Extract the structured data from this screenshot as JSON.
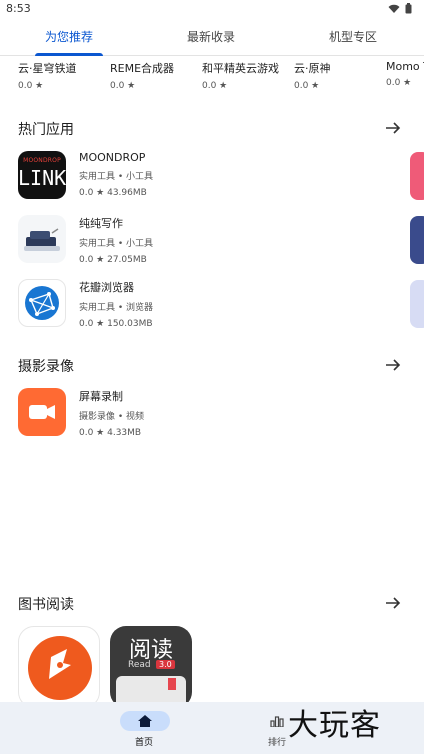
{
  "status": {
    "time": "8:53"
  },
  "tabs": [
    {
      "label": "为您推荐",
      "active": true
    },
    {
      "label": "最新收录",
      "active": false
    },
    {
      "label": "机型专区",
      "active": false
    }
  ],
  "top_row": [
    {
      "name": "云·星穹铁道",
      "rating": "0.0 ★"
    },
    {
      "name": "REME合成器",
      "rating": "0.0 ★"
    },
    {
      "name": "和平精英云游戏",
      "rating": "0.0 ★"
    },
    {
      "name": "云·原神",
      "rating": "0.0 ★"
    },
    {
      "name": "Momo T",
      "rating": "0.0 ★"
    }
  ],
  "sections": {
    "hot": {
      "title": "热门应用",
      "apps": [
        {
          "name": "MOONDROP",
          "category": "实用工具 • 小工具",
          "meta": "0.0 ★   43.96MB",
          "icon_text_top": "MOONDROP",
          "icon_text_main": "LINK"
        },
        {
          "name": "纯纯写作",
          "category": "实用工具 • 小工具",
          "meta": "0.0 ★   27.05MB"
        },
        {
          "name": "花瓣浏览器",
          "category": "实用工具 • 浏览器",
          "meta": "0.0 ★   150.03MB"
        }
      ]
    },
    "photo": {
      "title": "摄影录像",
      "apps": [
        {
          "name": "屏幕录制",
          "category": "摄影录像 • 视频",
          "meta": "0.0 ★   4.33MB"
        }
      ]
    },
    "books": {
      "title": "图书阅读",
      "apps": [
        {
          "icon": "orange-reader-icon"
        },
        {
          "icon": "read-icon",
          "icon_text": "阅读",
          "icon_subtext": "Read",
          "icon_badge": "3.0"
        }
      ]
    }
  },
  "bottom_nav": {
    "home_label": "首页",
    "rank_label": "排行"
  },
  "watermark": "大玩客",
  "colors": {
    "accent": "#0b57d0",
    "nav_bg": "#edf1f7",
    "pill": "#c9ddfb"
  }
}
